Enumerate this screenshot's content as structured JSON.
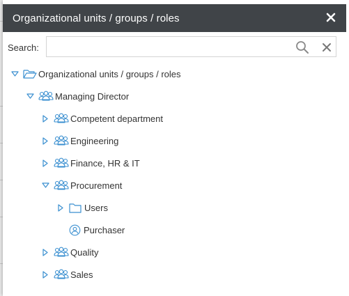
{
  "dialog": {
    "title": "Organizational units / groups / roles",
    "close_symbol": "✕"
  },
  "search": {
    "label": "Search:",
    "value": "",
    "placeholder": ""
  },
  "tree": [
    {
      "label": "Organizational units / groups / roles",
      "icon": "folder-open-icon",
      "expanded": true,
      "depth": 0
    },
    {
      "label": "Managing Director",
      "icon": "group-icon",
      "expanded": true,
      "depth": 1
    },
    {
      "label": "Competent department",
      "icon": "group-icon",
      "expanded": false,
      "depth": 2
    },
    {
      "label": "Engineering",
      "icon": "group-icon",
      "expanded": false,
      "depth": 2
    },
    {
      "label": "Finance, HR & IT",
      "icon": "group-icon",
      "expanded": false,
      "depth": 2
    },
    {
      "label": "Procurement",
      "icon": "group-icon",
      "expanded": true,
      "depth": 2
    },
    {
      "label": "Users",
      "icon": "folder-icon",
      "expanded": false,
      "depth": 3
    },
    {
      "label": "Purchaser",
      "icon": "role-icon",
      "expanded": null,
      "depth": 3
    },
    {
      "label": "Quality",
      "icon": "group-icon",
      "expanded": false,
      "depth": 2
    },
    {
      "label": "Sales",
      "icon": "group-icon",
      "expanded": false,
      "depth": 2
    }
  ],
  "colors": {
    "header_bg": "#404448",
    "icon_blue": "#3a8fd0"
  }
}
